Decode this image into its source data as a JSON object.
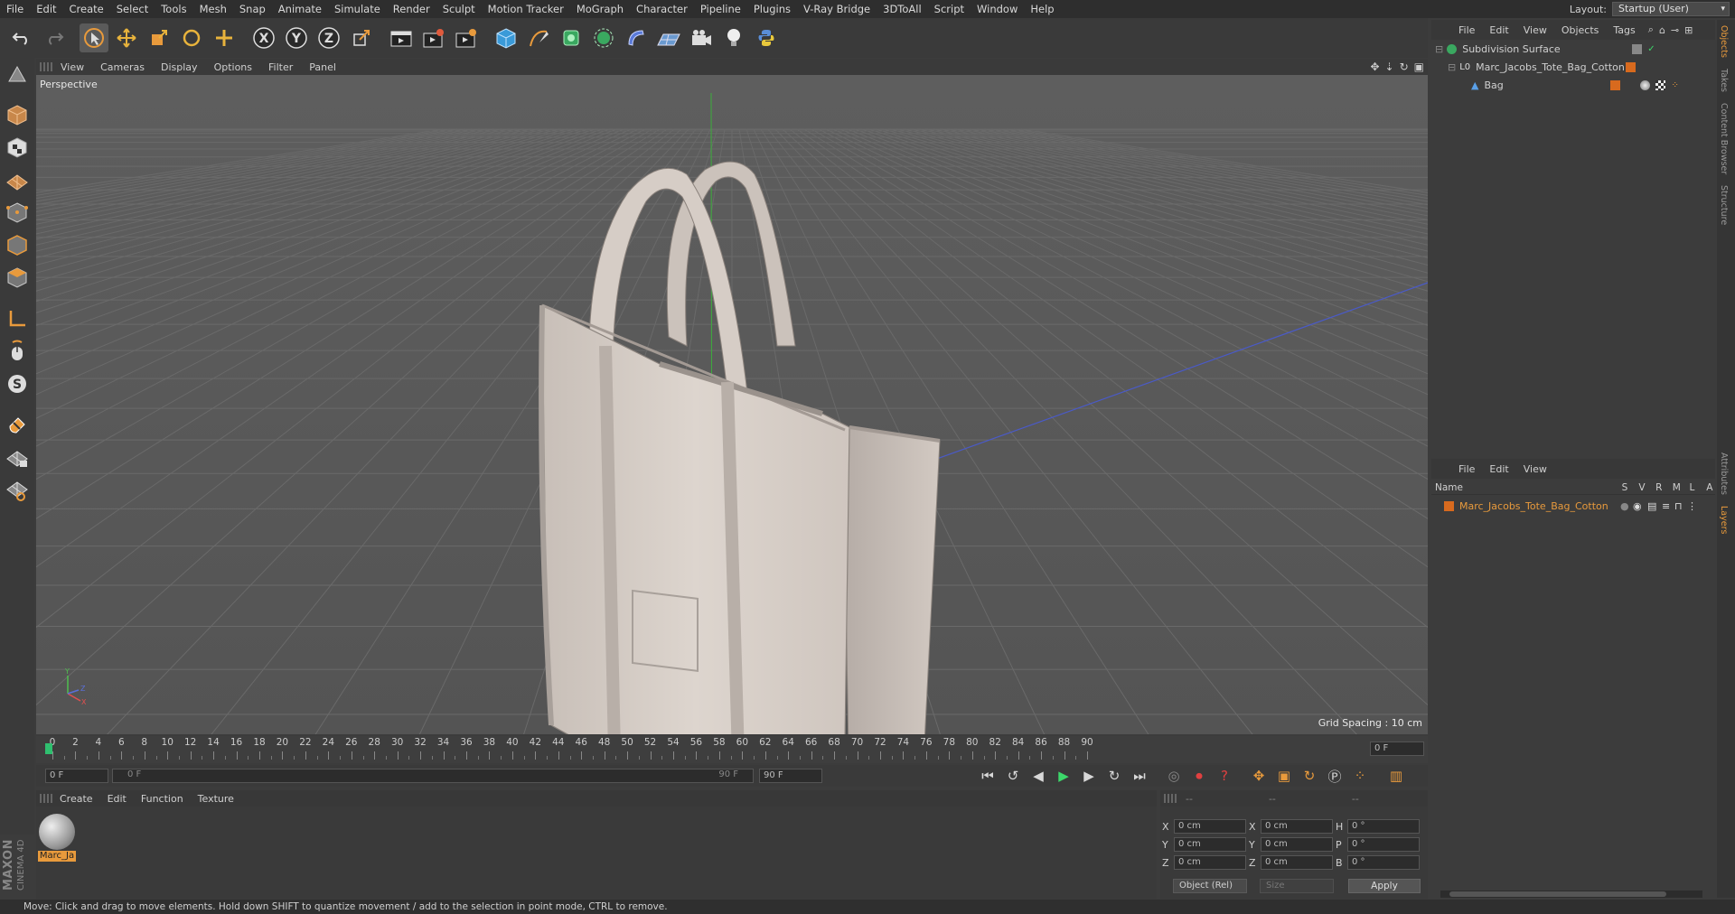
{
  "menus": [
    "File",
    "Edit",
    "Create",
    "Select",
    "Tools",
    "Mesh",
    "Snap",
    "Animate",
    "Simulate",
    "Render",
    "Sculpt",
    "Motion Tracker",
    "MoGraph",
    "Character",
    "Pipeline",
    "Plugins",
    "V-Ray Bridge",
    "3DToAll",
    "Script",
    "Window",
    "Help"
  ],
  "layout": {
    "label": "Layout:",
    "value": "Startup (User)"
  },
  "viewport_menu": [
    "View",
    "Cameras",
    "Display",
    "Options",
    "Filter",
    "Panel"
  ],
  "viewport": {
    "label": "Perspective",
    "grid_spacing": "Grid Spacing : 10 cm"
  },
  "timeline": {
    "ticks": [
      "0",
      "2",
      "4",
      "6",
      "8",
      "10",
      "12",
      "14",
      "16",
      "18",
      "20",
      "22",
      "24",
      "26",
      "28",
      "30",
      "32",
      "34",
      "36",
      "38",
      "40",
      "42",
      "44",
      "46",
      "48",
      "50",
      "52",
      "54",
      "56",
      "58",
      "60",
      "62",
      "64",
      "66",
      "68",
      "70",
      "72",
      "74",
      "76",
      "78",
      "80",
      "82",
      "84",
      "86",
      "88",
      "90"
    ],
    "current": "0 F"
  },
  "time_controls": {
    "start": "0 F",
    "slider_start": "0 F",
    "slider_end": "90 F",
    "end": "90 F"
  },
  "material_menu": [
    "Create",
    "Edit",
    "Function",
    "Texture"
  ],
  "material": {
    "name": "Marc_Ja"
  },
  "coords": {
    "headers": [
      "--",
      "--",
      "--"
    ],
    "x_label": "X",
    "y_label": "Y",
    "z_label": "Z",
    "x_pos": "0 cm",
    "y_pos": "0 cm",
    "z_pos": "0 cm",
    "x_size": "0 cm",
    "y_size": "0 cm",
    "z_size": "0 cm",
    "h_label": "H",
    "p_label": "P",
    "b_label": "B",
    "h": "0 °",
    "p": "0 °",
    "b": "0 °",
    "mode": "Object (Rel)",
    "size_mode": "Size",
    "apply": "Apply"
  },
  "status": "Move: Click and drag to move elements. Hold down SHIFT to quantize movement / add to the selection in point mode, CTRL to remove.",
  "object_menu": [
    "File",
    "Edit",
    "View",
    "Objects",
    "Tags"
  ],
  "objects": [
    {
      "name": "Subdivision Surface"
    },
    {
      "name": "Marc_Jacobs_Tote_Bag_Cotton"
    },
    {
      "name": "Bag"
    }
  ],
  "layer_menu": [
    "File",
    "Edit",
    "View"
  ],
  "layer_headers": {
    "name": "Name",
    "s": "S",
    "v": "V",
    "r": "R",
    "m": "M",
    "l": "L",
    "a": "A"
  },
  "layers": [
    {
      "name": "Marc_Jacobs_Tote_Bag_Cotton"
    }
  ],
  "side_tabs": [
    "Objects",
    "Takes",
    "Content Browser",
    "Structure",
    "Attributes",
    "Layers"
  ],
  "brand": {
    "top": "MAXON",
    "bottom": "CINEMA 4D"
  },
  "colors": {
    "accent": "#e89a3c",
    "layer_orange": "#d86a1e",
    "axis_x": "#e05050",
    "axis_y": "#4fbf4f",
    "axis_z": "#5a6fd8"
  }
}
